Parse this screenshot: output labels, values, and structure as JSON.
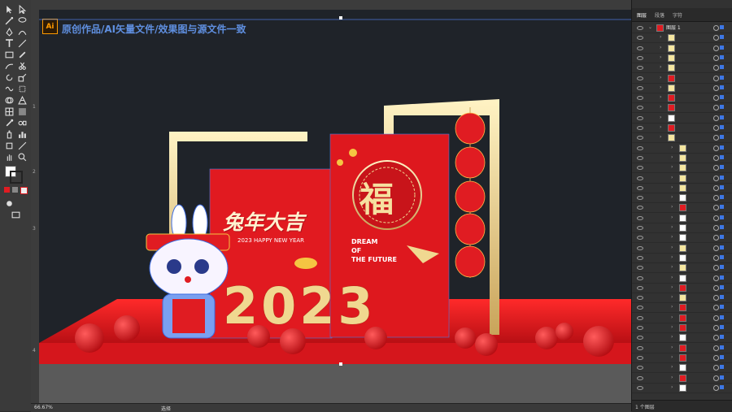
{
  "header": {
    "badge": "Ai",
    "caption": "原创作品/AI矢量文件/效果图与源文件一致"
  },
  "artwork": {
    "seal_char": "福",
    "headline": "兔年大吉",
    "subline": "2023 HAPPY NEW YEAR",
    "slogan_1": "DREAM",
    "slogan_2": "OF",
    "slogan_3": "THE FUTURE",
    "big_year": "2023"
  },
  "rulers": {
    "left_marks": [
      "1",
      "2",
      "3",
      "4"
    ]
  },
  "status": {
    "zoom": "66.67%",
    "mode": "选择"
  },
  "panel": {
    "tab_layers": "图层",
    "tab_para": "段落",
    "tab_char": "字符",
    "top_layer": "图层 1",
    "footer": "1 个图层"
  },
  "colors": {
    "accent": "#3d77e6",
    "stage_red": "#e01c22",
    "gold": "#f0d890",
    "canvas_bg": "#1f2329"
  }
}
